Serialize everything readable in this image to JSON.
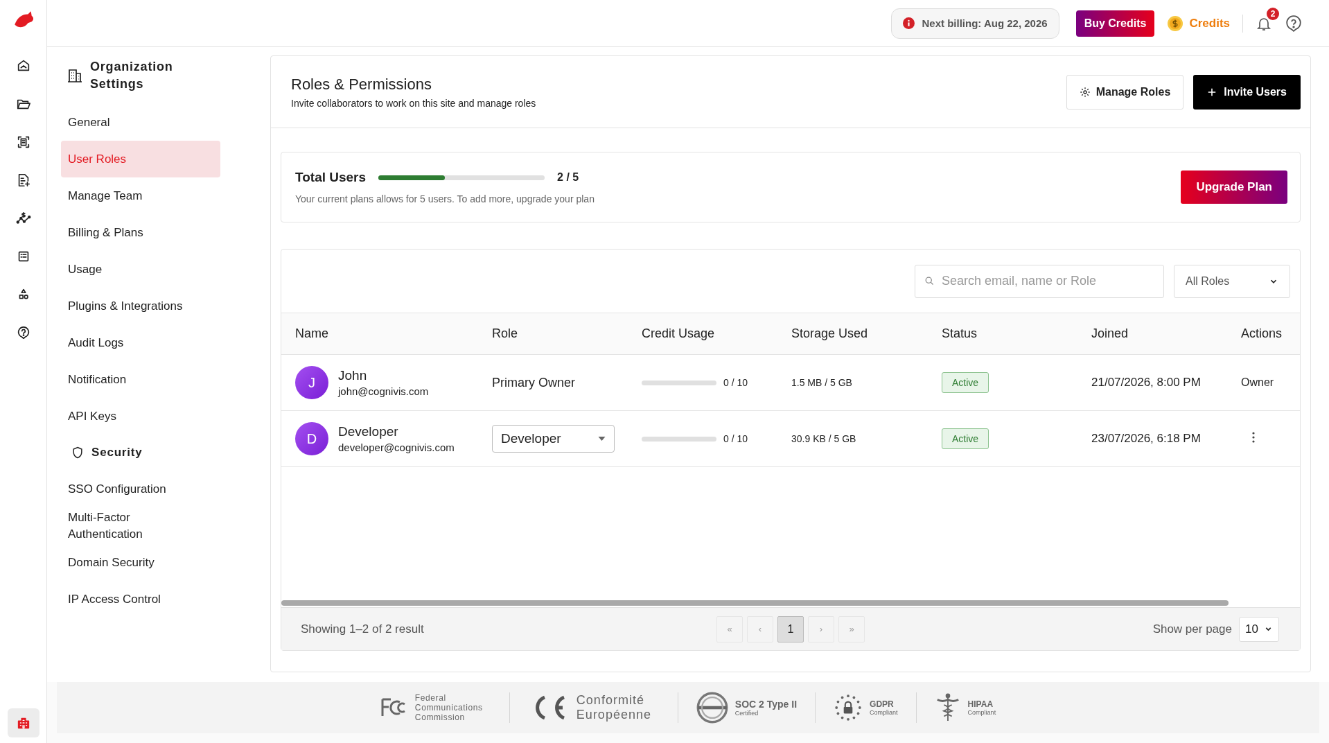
{
  "rail": [
    {
      "kind": "home",
      "selected": false
    },
    {
      "kind": "folder",
      "selected": false
    },
    {
      "kind": "scan",
      "selected": false
    },
    {
      "kind": "doc",
      "selected": false
    },
    {
      "kind": "chart",
      "selected": false
    },
    {
      "kind": "list",
      "selected": false
    },
    {
      "kind": "shapes",
      "selected": false
    },
    {
      "kind": "help",
      "selected": false
    },
    {
      "kind": "building",
      "selected": true
    }
  ],
  "topbar": {
    "billing": "Next billing: Aug 22, 2026",
    "buy_credits": "Buy Credits",
    "credits": "Credits",
    "notifications": "2"
  },
  "settings": {
    "title": "Organization Settings",
    "items": [
      {
        "kind": "item",
        "label": "General",
        "selected": false
      },
      {
        "kind": "item",
        "label": "User Roles",
        "selected": true
      },
      {
        "kind": "item",
        "label": "Manage Team",
        "selected": false
      },
      {
        "kind": "item",
        "label": "Billing & Plans",
        "selected": false
      },
      {
        "kind": "item",
        "label": "Usage",
        "selected": false
      },
      {
        "kind": "item",
        "label": "Plugins & Integrations",
        "selected": false
      },
      {
        "kind": "item",
        "label": "Audit Logs",
        "selected": false
      },
      {
        "kind": "item",
        "label": "Notification",
        "selected": false
      },
      {
        "kind": "item",
        "label": "API Keys",
        "selected": false
      },
      {
        "kind": "section",
        "label": "Security",
        "selected": false
      },
      {
        "kind": "item",
        "label": "SSO Configuration",
        "selected": false
      },
      {
        "kind": "item",
        "label": "Multi-Factor Authentication",
        "selected": false
      },
      {
        "kind": "item",
        "label": "Domain Security",
        "selected": false
      },
      {
        "kind": "item",
        "label": "IP Access Control",
        "selected": false
      }
    ]
  },
  "page": {
    "title": "Roles & Permissions",
    "subtitle": "Invite collaborators to work on this site and manage roles",
    "manage_roles": "Manage Roles",
    "invite_users": "Invite Users"
  },
  "usage": {
    "label": "Total Users",
    "level": 0.4,
    "reading": "2 / 5",
    "note": "Your current plans allows for 5 users. To add more, upgrade your plan",
    "upgrade": "Upgrade Plan"
  },
  "table": {
    "search": {
      "placeholder": "Search email, name or Role"
    },
    "role_filter": "All Roles",
    "columns": [
      "Name",
      "Role",
      "Credit Usage",
      "Storage Used",
      "Status",
      "Joined",
      "Actions"
    ],
    "rows": [
      {
        "initial": "J",
        "name": "John",
        "email": "john@cognivis.com",
        "role": {
          "kind": "text",
          "value": "Primary Owner"
        },
        "level": 0,
        "credit": "0 / 10",
        "storage": "1.5 MB / 5 GB",
        "status": "Active",
        "joined": "21/07/2026, 8:00 PM",
        "action": {
          "kind": "text",
          "value": "Owner"
        }
      },
      {
        "initial": "D",
        "name": "Developer",
        "email": "developer@cognivis.com",
        "role": {
          "kind": "select",
          "value": "Developer"
        },
        "level": 0,
        "credit": "0 / 10",
        "storage": "30.9 KB / 5 GB",
        "status": "Active",
        "joined": "23/07/2026, 6:18 PM",
        "action": {
          "kind": "menu"
        }
      }
    ]
  },
  "pagination": {
    "summary": "Showing 1–2 of 2 result",
    "pages": [
      {
        "label": "«",
        "selected": false
      },
      {
        "label": "‹",
        "selected": false
      },
      {
        "label": "1",
        "selected": true
      },
      {
        "label": "›",
        "selected": false
      },
      {
        "label": "»",
        "selected": false
      }
    ],
    "per_page_label": "Show per page",
    "per_page": "10"
  },
  "certifications": [
    {
      "kind": "fcc",
      "title": "Federal Communications Commission"
    },
    {
      "kind": "ce",
      "title": "Conformité Européenne"
    },
    {
      "kind": "soc",
      "title": "SOC 2 Type II",
      "subtitle": "Certified"
    },
    {
      "kind": "gdpr",
      "title": "GDPR",
      "subtitle": "Compliant"
    },
    {
      "kind": "hipaa",
      "title": "HIPAA",
      "subtitle": "Compliant"
    }
  ]
}
